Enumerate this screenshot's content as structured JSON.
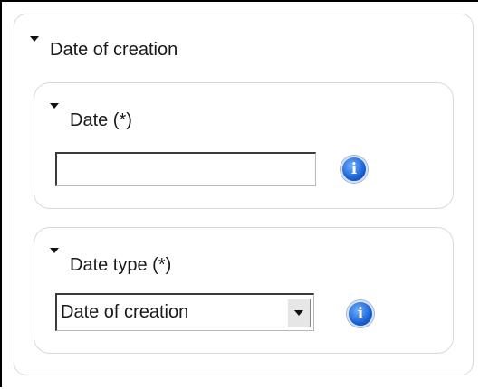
{
  "section": {
    "title": "Date of creation",
    "date_field": {
      "label": "Date (*)",
      "value": "",
      "info_icon": "info-icon"
    },
    "date_type_field": {
      "label": "Date type (*)",
      "selected": "Date of creation",
      "info_icon": "info-icon"
    }
  },
  "colors": {
    "info_blue": "#1b62d6",
    "card_border": "#d9d9d9"
  }
}
